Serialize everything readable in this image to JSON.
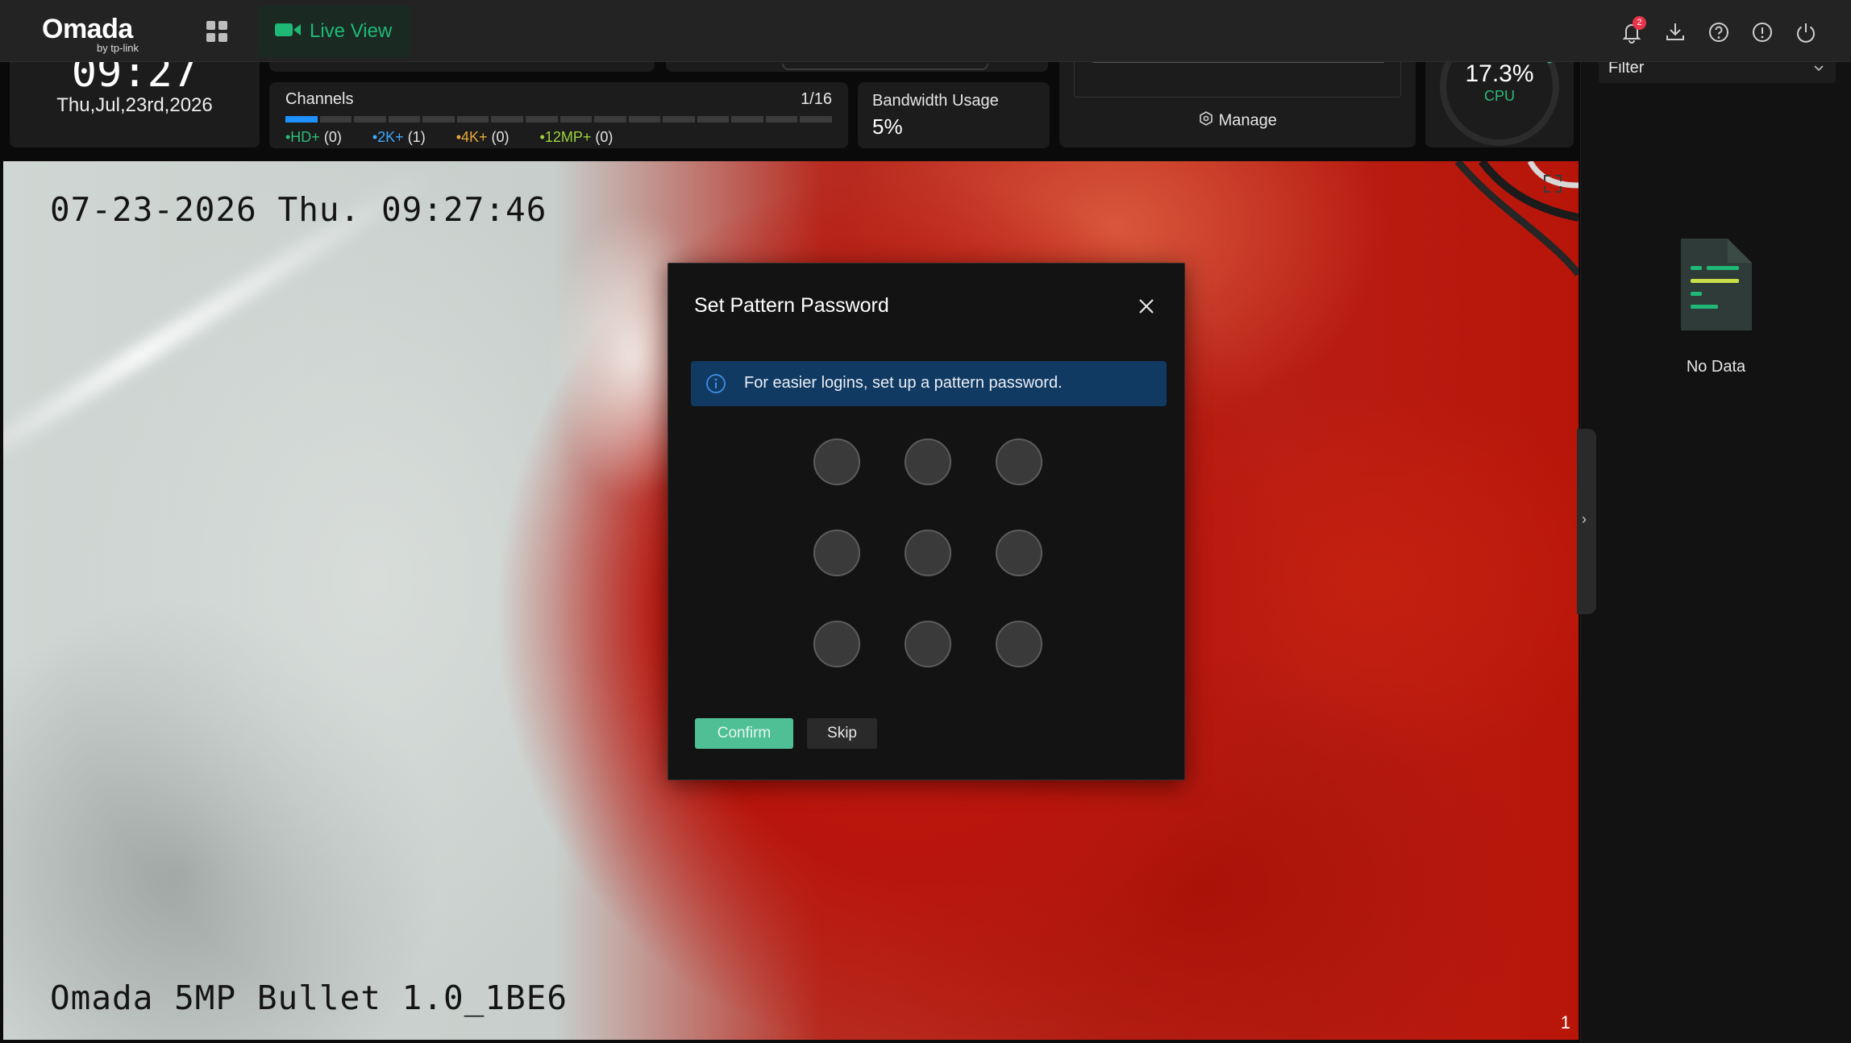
{
  "app": {
    "brand": "Omada",
    "brand_sub": "by tp-link",
    "live_view_label": "Live View",
    "notification_count": "2",
    "accent_color": "#1fb876"
  },
  "clock": {
    "time": "09:27",
    "date": "Thu,Jul,23rd,2026"
  },
  "channels": {
    "label": "Channels",
    "count": "1/16",
    "used": 1,
    "total": 16,
    "legend": [
      {
        "label": "•HD+",
        "value": "(0)",
        "color": "#2dbb79"
      },
      {
        "label": "•2K+",
        "value": "(1)",
        "color": "#3fa9ff"
      },
      {
        "label": "•4K+",
        "value": "(0)",
        "color": "#e8a83a"
      },
      {
        "label": "•12MP+",
        "value": "(0)",
        "color": "#9ed43b"
      }
    ]
  },
  "bandwidth": {
    "label": "Bandwidth Usage",
    "value": "5%"
  },
  "storage": {
    "manage_label": "Manage"
  },
  "cpu": {
    "value": "17.3%",
    "label": "CPU",
    "fraction": 0.173
  },
  "camera": {
    "timestamp": "07-23-2026 Thu. 09:27:46",
    "name": "Omada 5MP Bullet 1.0_1BE6",
    "index": "1"
  },
  "right_panel": {
    "filter_label": "Filter",
    "empty_label": "No Data"
  },
  "modal": {
    "title": "Set Pattern Password",
    "info": "For easier logins, set up a pattern password.",
    "confirm_label": "Confirm",
    "skip_label": "Skip",
    "info_color": "#113a63",
    "confirm_color": "#4fbf96"
  }
}
